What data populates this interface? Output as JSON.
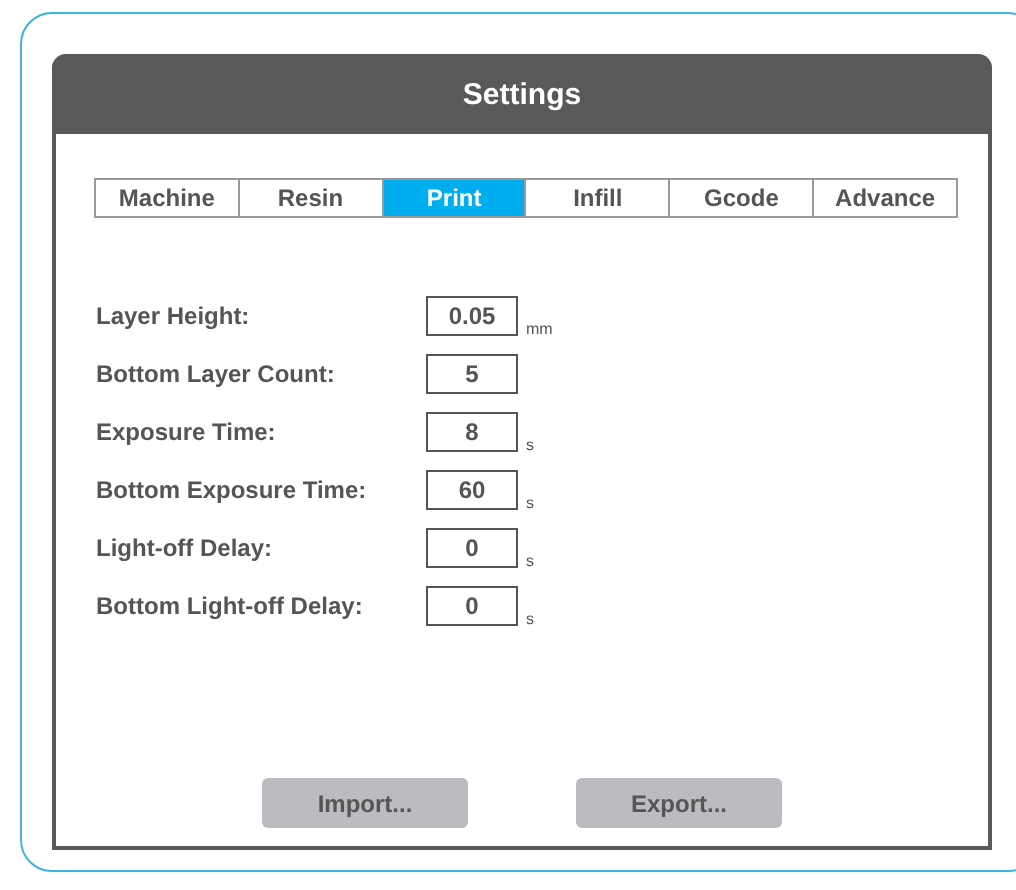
{
  "window": {
    "title": "Settings"
  },
  "tabs": [
    {
      "label": "Machine",
      "selected": false
    },
    {
      "label": "Resin",
      "selected": false
    },
    {
      "label": "Print",
      "selected": true
    },
    {
      "label": "Infill",
      "selected": false
    },
    {
      "label": "Gcode",
      "selected": false
    },
    {
      "label": "Advance",
      "selected": false
    }
  ],
  "fields": [
    {
      "label": "Layer Height:",
      "value": "0.05",
      "unit": "mm"
    },
    {
      "label": "Bottom Layer Count:",
      "value": "5"
    },
    {
      "label": "Exposure Time:",
      "value": "8",
      "unit": "s"
    },
    {
      "label": "Bottom Exposure Time:",
      "value": "60",
      "unit": "s"
    },
    {
      "label": "Light-off Delay:",
      "value": "0",
      "unit": "s"
    },
    {
      "label": "Bottom Light-off Delay:",
      "value": "0",
      "unit": "s"
    }
  ],
  "buttons": [
    "Import...",
    "Export..."
  ]
}
